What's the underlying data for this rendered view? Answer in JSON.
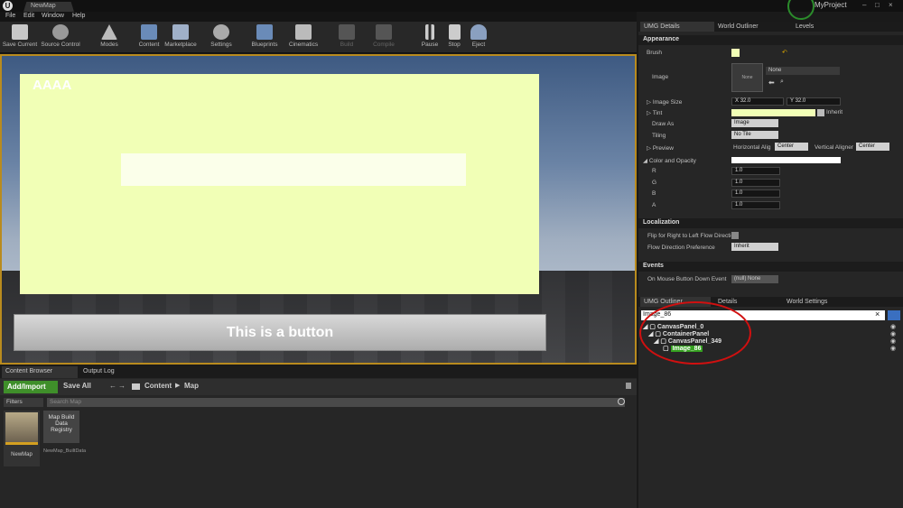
{
  "titlebar": {
    "tab": "NewMap",
    "project": "MyProject"
  },
  "menu": [
    "File",
    "Edit",
    "Window",
    "Help"
  ],
  "toolbar": {
    "save_current": "Save Current",
    "source_control": "Source Control",
    "modes": "Modes",
    "content": "Content",
    "marketplace": "Marketplace",
    "settings": "Settings",
    "blueprints": "Blueprints",
    "cinematics": "Cinematics",
    "build": "Build",
    "compile": "Compile",
    "pause": "Pause",
    "stop": "Stop",
    "eject": "Eject"
  },
  "viewport": {
    "overlay_text": "AAAA",
    "button_text": "This is a button"
  },
  "content_browser": {
    "tab1": "Content Browser",
    "tab2": "Output Log",
    "add_import": "Add/Import",
    "save_all": "Save All",
    "path": [
      "Content",
      "Map"
    ],
    "filters": "Filters",
    "search_placeholder": "Search Map",
    "assets": [
      {
        "name": "NewMap",
        "sub": ""
      },
      {
        "name": "Map Build Data Registry",
        "sub": "NewMap_BuiltData"
      }
    ]
  },
  "right_tabs": [
    "UMG Details",
    "World Outliner",
    "Levels"
  ],
  "details": {
    "appearance": "Appearance",
    "brush": "Brush",
    "image": "Image",
    "image_thumb": "None",
    "image_value": "None",
    "image_size": "Image Size",
    "x_label": "X",
    "x_value": "32.0",
    "y_label": "Y",
    "y_value": "32.0",
    "tint": "Tint",
    "inherit": "Inherit",
    "draw_as": "Draw As",
    "draw_as_value": "Image",
    "tiling": "Tiling",
    "tiling_value": "No Tile",
    "preview": "Preview",
    "horizontal_align": "Horizontal Alig",
    "h_value": "Center",
    "vertical_aligner": "Vertical Aligner",
    "v_value": "Center",
    "color_opacity": "Color and Opacity",
    "r": "R",
    "g": "G",
    "b": "B",
    "a": "A",
    "r_value": "1.0",
    "g_value": "1.0",
    "b_value": "1.0",
    "a_value": "1.0",
    "localization": "Localization",
    "flip_rtl": "Flip for Right to Left Flow Direction",
    "flow_pref": "Flow Direction Preference",
    "flow_value": "Inherit",
    "events": "Events",
    "mouse_down": "On Mouse Button Down Event",
    "mouse_down_value": "(null) None"
  },
  "bottom_tabs": [
    "UMG Outliner",
    "Details",
    "World Settings"
  ],
  "outliner": {
    "search_value": "Image_86",
    "items": [
      "CanvasPanel_0",
      "ContainerPanel",
      "CanvasPanel_349",
      "Image_86"
    ]
  },
  "colors": {
    "selection_border": "#b98b1e",
    "highlight": "#f1ffb6",
    "add_button": "#3f8f2a",
    "annotation": "#d01010"
  }
}
